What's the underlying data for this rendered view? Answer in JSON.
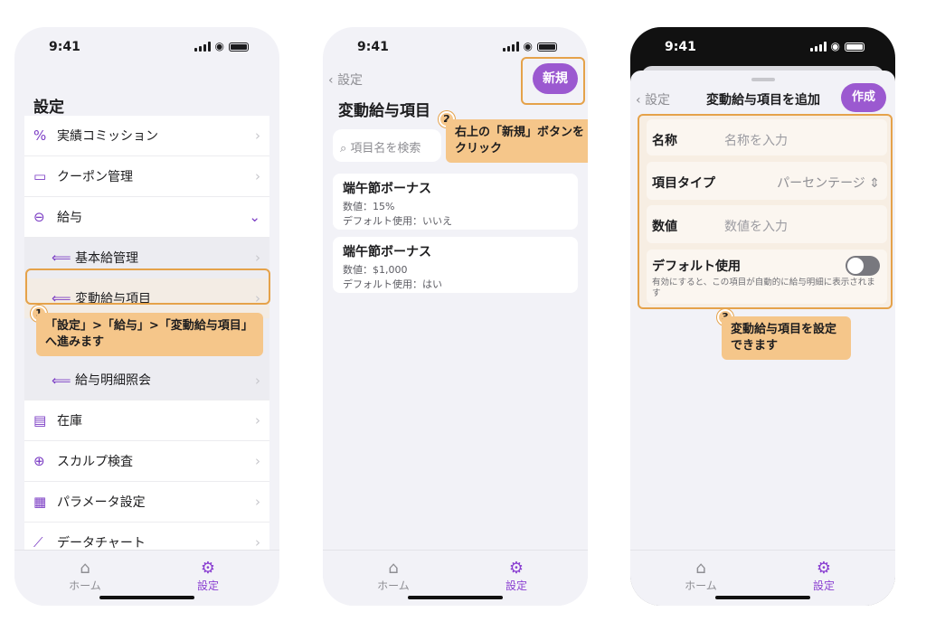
{
  "status": {
    "time": "9:41"
  },
  "tabbar": {
    "home": "ホーム",
    "settings": "設定"
  },
  "screen1": {
    "title": "設定",
    "rows": [
      {
        "label": "実績コミッション",
        "icon": "%"
      },
      {
        "label": "クーポン管理",
        "icon": "▭"
      },
      {
        "label": "給与",
        "icon": "⊖"
      },
      {
        "label": "基本給管理",
        "icon": "⟸"
      },
      {
        "label": "変動給与項目",
        "icon": "⟸"
      },
      {
        "label": "給与明細照会",
        "icon": "⟸"
      },
      {
        "label": "在庫",
        "icon": "▤"
      },
      {
        "label": "スカルプ検査",
        "icon": "⊕"
      },
      {
        "label": "パラメータ設定",
        "icon": "▦"
      },
      {
        "label": "データチャート",
        "icon": "⟋"
      }
    ],
    "callout_num": "1",
    "callout_text": "「設定」>「給与」>「変動給与項目」へ進みます"
  },
  "screen2": {
    "back_label": "設定",
    "title": "変動給与項目",
    "new_button": "新規",
    "search_placeholder": "項目名を検索",
    "callout_num": "2",
    "callout_text": "右上の「新規」ボタンをクリック",
    "items": [
      {
        "title": "端午節ボーナス",
        "value": "数値：15%",
        "default": "デフォルト使用：いいえ"
      },
      {
        "title": "端午節ボーナス",
        "value": "数値：$1,000",
        "default": "デフォルト使用：はい"
      }
    ]
  },
  "screen3": {
    "back_label": "設定",
    "title": "変動給与項目を追加",
    "create_button": "作成",
    "name_label": "名称",
    "name_placeholder": "名称を入力",
    "type_label": "項目タイプ",
    "type_value": "パーセンテージ",
    "value_label": "数値",
    "value_placeholder": "数値を入力",
    "default_label": "デフォルト使用",
    "default_on": false,
    "default_hint": "有効にすると、この項目が自動的に給与明細に表示されます",
    "callout_num": "3",
    "callout_text": "変動給与項目を設定できます"
  }
}
